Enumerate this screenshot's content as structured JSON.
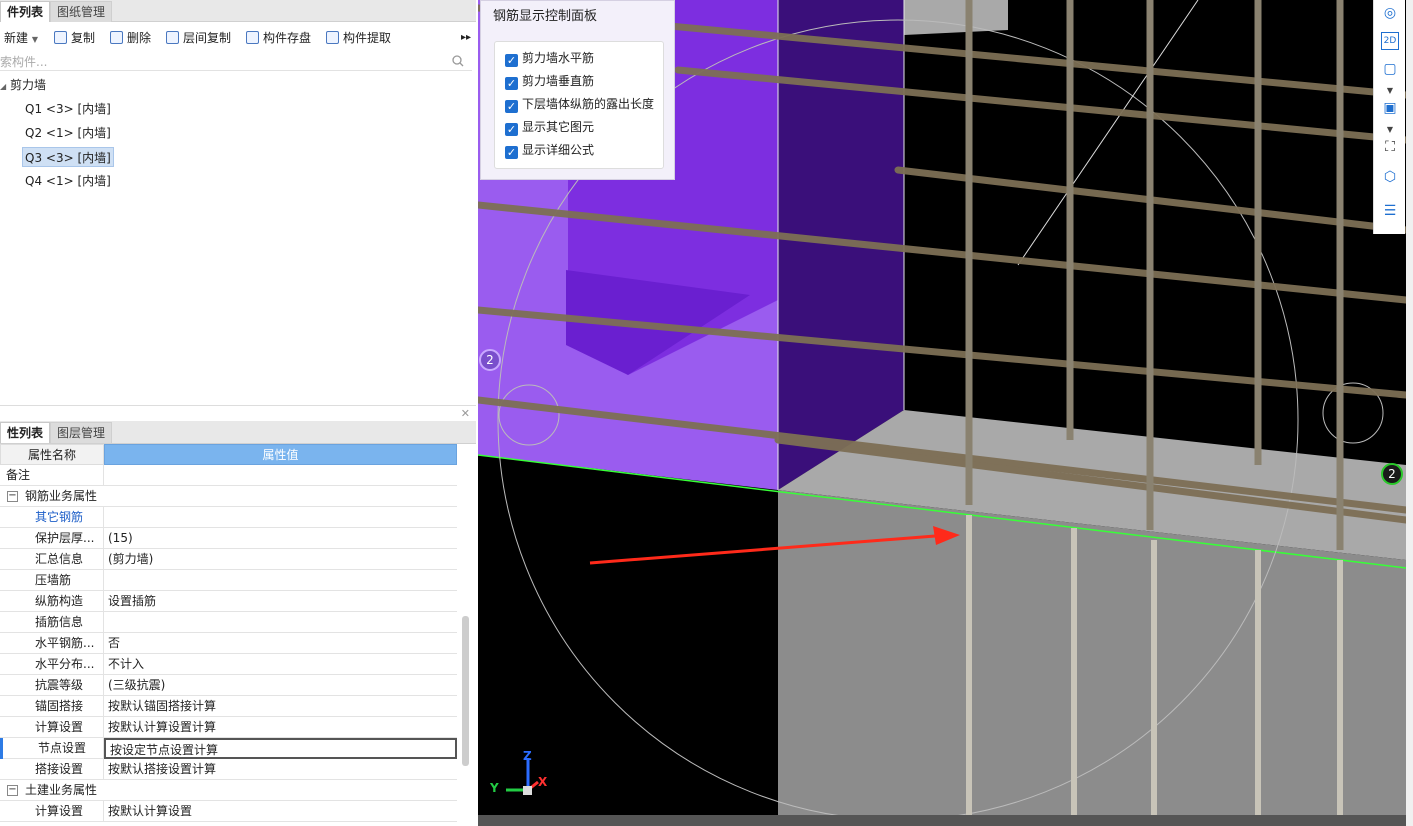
{
  "left_top": {
    "tabs": [
      {
        "label": "件列表"
      },
      {
        "label": "图纸管理"
      }
    ],
    "toolbar": [
      {
        "label": "新建"
      },
      {
        "label": "复制"
      },
      {
        "label": "删除"
      },
      {
        "label": "层间复制"
      },
      {
        "label": "构件存盘"
      },
      {
        "label": "构件提取"
      }
    ],
    "search_placeholder": "索构件...",
    "tree": {
      "root": "剪力墙",
      "items": [
        {
          "label": "Q1 <3> [内墙]"
        },
        {
          "label": "Q2 <1> [内墙]"
        },
        {
          "label": "Q3 <3> [内墙]"
        },
        {
          "label": "Q4 <1> [内墙]"
        }
      ]
    }
  },
  "left_bottom": {
    "tabs": [
      {
        "label": "性列表"
      },
      {
        "label": "图层管理"
      }
    ],
    "header": {
      "name": "属性名称",
      "value": "属性值"
    },
    "rows": [
      {
        "name": "备注",
        "value": ""
      },
      {
        "name": "钢筋业务属性",
        "value": ""
      },
      {
        "name": "其它钢筋",
        "value": ""
      },
      {
        "name": "保护层厚...",
        "value": "(15)"
      },
      {
        "name": "汇总信息",
        "value": "(剪力墙)"
      },
      {
        "name": "压墙筋",
        "value": ""
      },
      {
        "name": "纵筋构造",
        "value": "设置插筋"
      },
      {
        "name": "插筋信息",
        "value": ""
      },
      {
        "name": "水平钢筋...",
        "value": "否"
      },
      {
        "name": "水平分布...",
        "value": "不计入"
      },
      {
        "name": "抗震等级",
        "value": "(三级抗震)"
      },
      {
        "name": "锚固搭接",
        "value": "按默认锚固搭接计算"
      },
      {
        "name": "计算设置",
        "value": "按默认计算设置计算"
      },
      {
        "name": "节点设置",
        "value": "按设定节点设置计算"
      },
      {
        "name": "搭接设置",
        "value": "按默认搭接设置计算"
      },
      {
        "name": "土建业务属性",
        "value": ""
      },
      {
        "name": "计算设置",
        "value": "按默认计算设置"
      }
    ]
  },
  "panel": {
    "title": "钢筋显示控制面板",
    "options": [
      {
        "label": "剪力墙水平筋",
        "checked": true
      },
      {
        "label": "剪力墙垂直筋",
        "checked": true
      },
      {
        "label": "下层墙体纵筋的露出长度",
        "checked": true
      },
      {
        "label": "显示其它图元",
        "checked": true
      },
      {
        "label": "显示详细公式",
        "checked": true
      }
    ]
  },
  "viewport": {
    "axis_markers": [
      "2",
      "2"
    ],
    "axes": [
      "Z",
      "Y",
      "X"
    ]
  },
  "right_tools": [
    {
      "icon": "rotate-icon"
    },
    {
      "icon": "2d-icon"
    },
    {
      "icon": "cube-icon"
    },
    {
      "icon": "shaded-cube-icon"
    },
    {
      "icon": "fullscreen-icon"
    },
    {
      "icon": "cube-view-icon"
    },
    {
      "icon": "properties-icon"
    }
  ],
  "colors": {
    "accent": "#1e6fd0",
    "header_blue": "#7ab4ee",
    "purple": "#8c4fe6",
    "arrow_red": "#ff2a1a"
  }
}
